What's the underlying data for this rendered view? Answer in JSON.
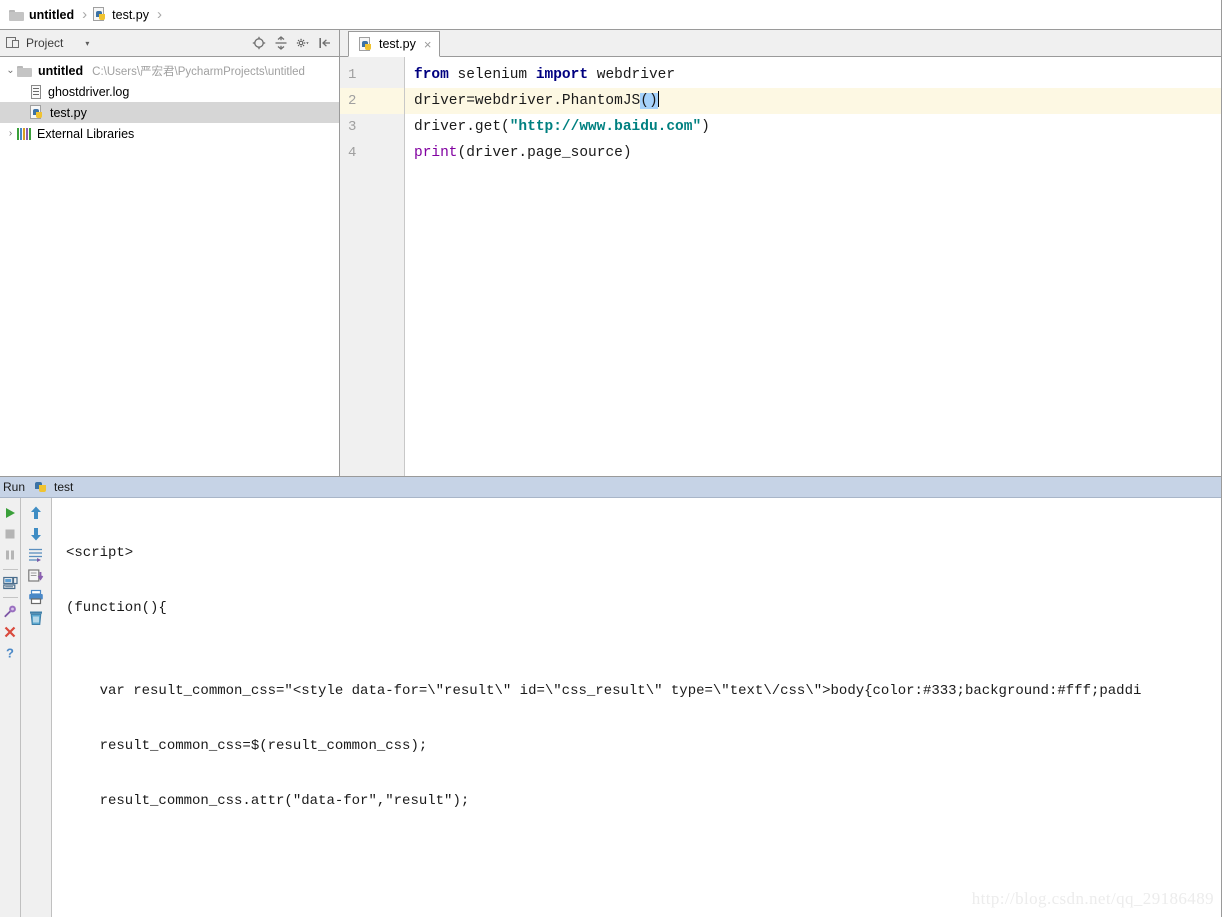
{
  "breadcrumb": {
    "items": [
      {
        "label": "untitled",
        "icon": "folder-icon",
        "bold": true
      },
      {
        "label": "test.py",
        "icon": "python-file-icon",
        "bold": false
      }
    ],
    "separator": "›"
  },
  "project_panel": {
    "title": "Project",
    "caret": "▾",
    "tools": [
      {
        "name": "locate-target-icon"
      },
      {
        "name": "collapse-all-icon"
      },
      {
        "name": "settings-gear-icon"
      },
      {
        "name": "hide-panel-icon"
      }
    ],
    "tree": [
      {
        "label": "untitled",
        "path": "C:\\Users\\严宏君\\PycharmProjects\\untitled",
        "icon": "folder-icon",
        "twisty": "⌄",
        "indent": 0,
        "bold": true,
        "selected": false
      },
      {
        "label": "ghostdriver.log",
        "path": "",
        "icon": "log-file-icon",
        "twisty": "",
        "indent": 1,
        "bold": false,
        "selected": false
      },
      {
        "label": "test.py",
        "path": "",
        "icon": "python-file-icon",
        "twisty": "",
        "indent": 1,
        "bold": false,
        "selected": true
      },
      {
        "label": "External Libraries",
        "path": "",
        "icon": "external-libraries-icon",
        "twisty": "›",
        "indent": 0,
        "bold": false,
        "selected": false
      }
    ]
  },
  "editor": {
    "tabs": [
      {
        "label": "test.py",
        "icon": "python-file-icon",
        "close": "×",
        "active": true
      }
    ],
    "line_numbers": [
      "1",
      "2",
      "3",
      "4"
    ],
    "active_line": 2,
    "lines": [
      "from selenium import webdriver",
      "driver=webdriver.PhantomJS()",
      "driver.get(\"http://www.baidu.com\")",
      "print(driver.page_source)"
    ]
  },
  "run_panel": {
    "title": "Run",
    "tab_label": "test",
    "tab_icon": "python-icon",
    "toolbar_left": [
      {
        "name": "run-button-icon",
        "glyph": "▶",
        "color": "#3aa03a"
      },
      {
        "name": "stop-button-icon",
        "glyph": "■",
        "color": "#b5b5b5"
      },
      {
        "name": "pause-button-icon",
        "glyph": "‖",
        "color": "#b5b5b5"
      },
      {
        "name": "console-view-icon",
        "glyph": "",
        "color": "#4a88c7"
      },
      {
        "name": "pin-tab-icon",
        "glyph": "",
        "color": "#8a5fb0"
      },
      {
        "name": "close-tab-icon",
        "glyph": "✕",
        "color": "#d94a3d"
      },
      {
        "name": "help-icon",
        "glyph": "?",
        "color": "#4a88c7"
      }
    ],
    "toolbar_right": [
      {
        "name": "up-arrow-icon",
        "glyph": "⬆",
        "color": "#4a88c7"
      },
      {
        "name": "down-arrow-icon",
        "glyph": "⬇",
        "color": "#4a88c7"
      },
      {
        "name": "soft-wrap-icon",
        "glyph": "",
        "color": "#5b8fbf"
      },
      {
        "name": "scroll-to-end-icon",
        "glyph": "",
        "color": "#8a5fb0"
      },
      {
        "name": "print-icon",
        "glyph": "",
        "color": "#4a88c7"
      },
      {
        "name": "clear-all-icon",
        "glyph": "",
        "color": "#4a88c7"
      }
    ],
    "console_lines": [
      "<script>",
      "(function(){",
      "",
      "    var result_common_css=\"<style data-for=\\\"result\\\" id=\\\"css_result\\\" type=\\\"text\\/css\\\">body{color:#333;background:#fff;paddi",
      "    result_common_css=$(result_common_css);",
      "    result_common_css.attr(\"data-for\",\"result\");"
    ]
  },
  "watermark": "http://blog.csdn.net/qq_29186489",
  "colors": {
    "keyword": "#000080",
    "string": "#008080",
    "function": "#8000a0",
    "selection": "#a6d2fa",
    "current_line": "#fdf8e3",
    "gutter_bg": "#f0f0f0",
    "run_header_bg": "#c6d3e6",
    "tree_selected_bg": "#d6d6d6",
    "border": "#9a9a9a"
  }
}
